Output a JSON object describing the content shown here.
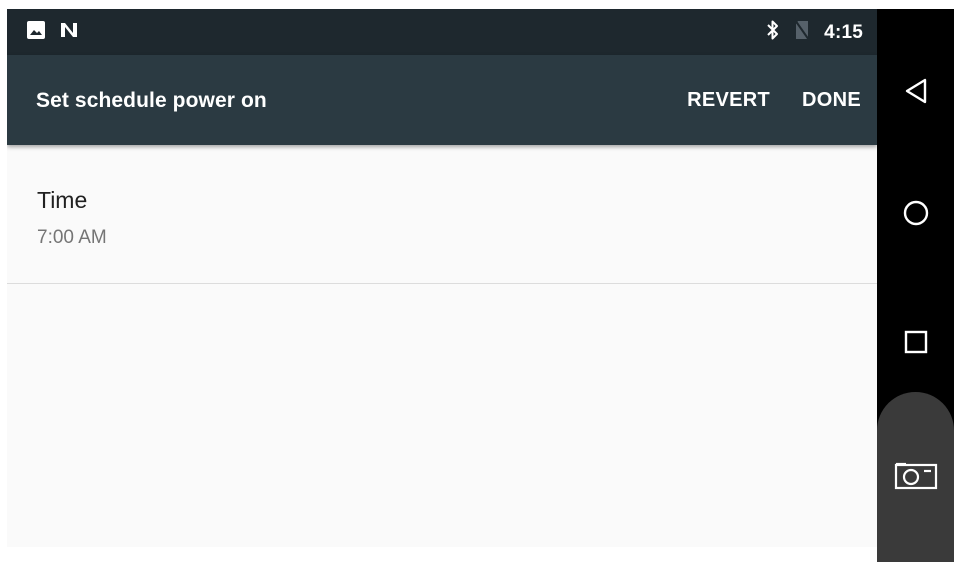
{
  "status_bar": {
    "time": "4:15",
    "left_icons": [
      "image-notification-icon",
      "n-notification-icon"
    ],
    "right_icons": [
      "bluetooth-icon",
      "no-sim-icon"
    ]
  },
  "app_bar": {
    "title": "Set schedule power on",
    "revert_label": "REVERT",
    "done_label": "DONE"
  },
  "preference": {
    "title": "Time",
    "summary": "7:00 AM"
  },
  "nav_bar": {
    "buttons": [
      "back-icon",
      "home-icon",
      "recents-icon",
      "camera-icon"
    ]
  },
  "colors": {
    "status_bar_bg": "#1e282e",
    "app_bar_bg": "#2b3a42",
    "content_bg": "#fafafa",
    "nav_bar_bg": "#000000"
  }
}
